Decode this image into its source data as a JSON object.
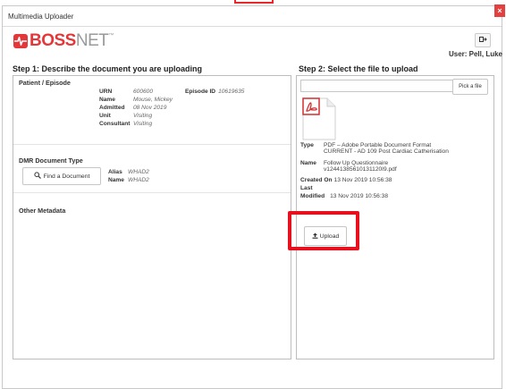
{
  "window": {
    "title": "Multimedia Uploader"
  },
  "logo": {
    "brand_a": "BOSS",
    "brand_b": "NET",
    "tm": "™"
  },
  "user": {
    "line": "User: Pell, Luke"
  },
  "step1": {
    "title": "Step 1: Describe the document you are uploading",
    "patient": {
      "label": "Patient / Episode",
      "urn_k": "URN",
      "urn_v": "600600",
      "episode_k": "Episode ID",
      "episode_v": "10619635",
      "name_k": "Name",
      "name_v": "Mouse, Mickey",
      "admitted_k": "Admitted",
      "admitted_v": "08 Nov 2019",
      "unit_k": "Unit",
      "unit_v": "Visiting",
      "consultant_k": "Consultant",
      "consultant_v": "Visiting"
    },
    "dmr": {
      "label": "DMR Document Type",
      "find_button": "Find a Document",
      "alias_k": "Alias",
      "alias_v": "WHAD2",
      "name_k": "Name",
      "name_v": "WHAD2"
    },
    "other": {
      "label": "Other Metadata"
    }
  },
  "step2": {
    "title": "Step 2: Select the file to upload",
    "pick_button": "Pick a file",
    "file_input_value": "",
    "meta": {
      "type_k": "Type",
      "type_v1": "PDF – Adobe Portable Document Format",
      "type_v2": "CURRENT - AD 109 Post Cardiac Catherisation",
      "name_k": "Name",
      "name_v1": "Follow Up Questionnaire",
      "name_v2": "v12441385610131120I9.pdf",
      "created_k": "Created On",
      "created_v": "13 Nov 2019 10:56:38",
      "last_k": "Last",
      "modified_k": "Modified",
      "modified_v": "13 Nov 2019 10:56:38"
    },
    "upload_button": "Upload"
  },
  "colors": {
    "brand": "#e3373a",
    "highlight": "#e8101c"
  },
  "icons": {
    "logout": "logout-icon",
    "search": "search-icon",
    "upload": "upload-icon",
    "pdf": "pdf-file-icon",
    "close": "close-icon"
  }
}
